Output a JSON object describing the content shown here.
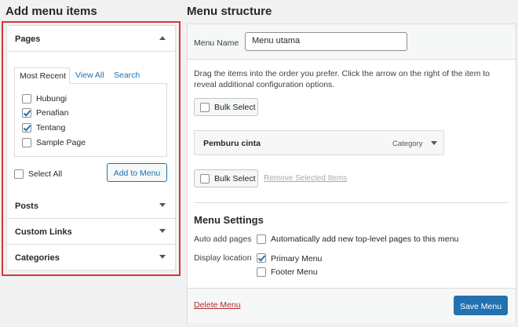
{
  "left": {
    "title": "Add menu items",
    "sections": [
      {
        "label": "Pages",
        "expanded": true
      },
      {
        "label": "Posts",
        "expanded": false
      },
      {
        "label": "Custom Links",
        "expanded": false
      },
      {
        "label": "Categories",
        "expanded": false
      }
    ],
    "tabs": [
      {
        "label": "Most Recent",
        "active": true
      },
      {
        "label": "View All",
        "active": false
      },
      {
        "label": "Search",
        "active": false
      }
    ],
    "pages": [
      {
        "label": "Hubungi",
        "checked": false
      },
      {
        "label": "Penafian",
        "checked": true
      },
      {
        "label": "Tentang",
        "checked": true
      },
      {
        "label": "Sample Page",
        "checked": false
      }
    ],
    "select_all_label": "Select All",
    "add_to_menu_label": "Add to Menu"
  },
  "right": {
    "title": "Menu structure",
    "menu_name_label": "Menu Name",
    "menu_name_value": "Menu utama",
    "instructions": "Drag the items into the order you prefer. Click the arrow on the right of the item to reveal additional configuration options.",
    "bulk_select_label": "Bulk Select",
    "menu_item": {
      "title": "Pemburu cinta",
      "type": "Category"
    },
    "remove_selected_label": "Remove Selected Items",
    "settings_title": "Menu Settings",
    "auto_add_label": "Auto add pages",
    "auto_add_option": "Automatically add new top-level pages to this menu",
    "display_location_label": "Display location",
    "locations": [
      {
        "label": "Primary Menu",
        "checked": true
      },
      {
        "label": "Footer Menu",
        "checked": false
      }
    ],
    "delete_menu_label": "Delete Menu",
    "save_menu_label": "Save Menu"
  },
  "colors": {
    "accent": "#2271b1",
    "highlight": "#d63638",
    "delete": "#b32d2e"
  }
}
